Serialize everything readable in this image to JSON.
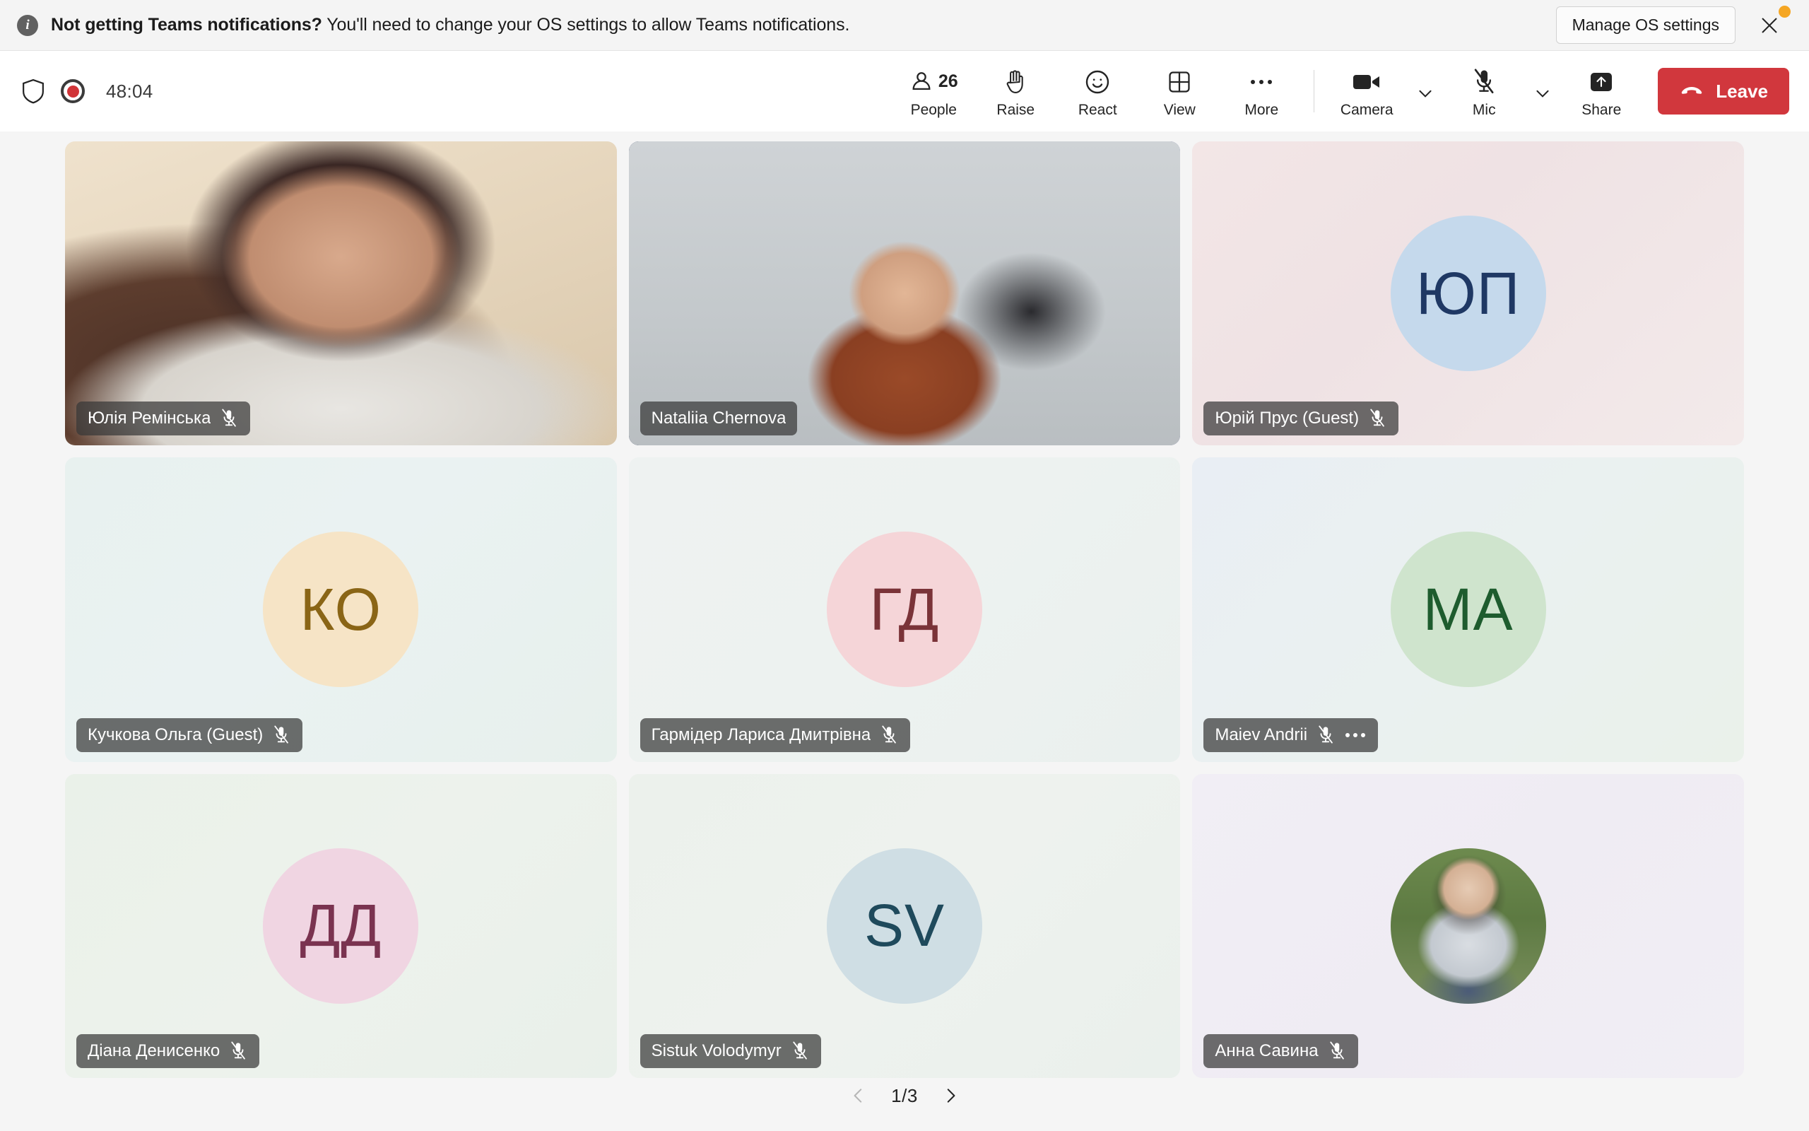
{
  "banner": {
    "icon": "info-icon",
    "title": "Not getting Teams notifications?",
    "message": " You'll need to change your OS settings to allow Teams notifications.",
    "action_label": "Manage OS settings",
    "close_icon": "close-icon",
    "badge_color": "#f5a623"
  },
  "toolbar": {
    "shield_icon": "shield-icon",
    "recording_icon": "record-icon",
    "recording_color": "#d13438",
    "timer": "48:04",
    "items": [
      {
        "label": "People",
        "icon": "people-icon",
        "count": "26"
      },
      {
        "label": "Raise",
        "icon": "raise-hand-icon"
      },
      {
        "label": "React",
        "icon": "react-smiley-icon"
      },
      {
        "label": "View",
        "icon": "view-grid-icon"
      },
      {
        "label": "More",
        "icon": "more-ellipsis-icon"
      }
    ],
    "camera": {
      "label": "Camera",
      "icon": "camera-icon",
      "chevron": "chevron-down-icon"
    },
    "mic": {
      "label": "Mic",
      "icon": "mic-muted-icon",
      "chevron": "chevron-down-icon"
    },
    "share": {
      "label": "Share",
      "icon": "share-screen-icon"
    },
    "leave": {
      "label": "Leave",
      "icon": "call-end-icon",
      "color": "#d1373d"
    }
  },
  "grid": {
    "tiles": [
      {
        "name": "Юлія Ремінська",
        "kind": "video",
        "photo_class": "ph-yuliia",
        "muted": true,
        "active_speaker": false,
        "has_overflow": false
      },
      {
        "name": "Nataliia Chernova",
        "kind": "video",
        "photo_class": "ph-nataliia",
        "muted": false,
        "active_speaker": true,
        "has_overflow": false
      },
      {
        "name": "Юрій Прус (Guest)",
        "kind": "initials",
        "initials": "ЮП",
        "avatar_bg": "#c5d9ec",
        "avatar_fg": "#1f3864",
        "tile_bg": "linear-gradient(135deg, #f3e6e6 0%, #efe2e4 40%, #f3eaea 100%)",
        "muted": true,
        "active_speaker": false,
        "has_overflow": false
      },
      {
        "name": "Кучкова Ольга (Guest)",
        "kind": "initials",
        "initials": "КО",
        "avatar_bg": "#f6e4c6",
        "avatar_fg": "#8a6516",
        "tile_bg": "linear-gradient(135deg, #e8f1ef 0%, #eaf2f2 45%, #e7f0ec 100%)",
        "muted": true,
        "active_speaker": false,
        "has_overflow": false
      },
      {
        "name": "Гармідер Лариса Дмитрівна",
        "kind": "initials",
        "initials": "ГД",
        "avatar_bg": "#f5d5d8",
        "avatar_fg": "#7a3338",
        "tile_bg": "linear-gradient(135deg, #eef2f1 0%, #edf2f0 50%, #eaf0ee 100%)",
        "muted": true,
        "active_speaker": false,
        "has_overflow": false
      },
      {
        "name": "Maiev Andrii",
        "kind": "initials",
        "initials": "МА",
        "avatar_bg": "#cfe4cd",
        "avatar_fg": "#1e5c2e",
        "tile_bg": "linear-gradient(135deg, #e9eef4 0%, #eaf1f0 50%, #eaf1ea 100%)",
        "muted": true,
        "active_speaker": false,
        "has_overflow": true,
        "overflow_icon": "more-ellipsis-icon"
      },
      {
        "name": "Діана Денисенко",
        "kind": "initials",
        "initials": "ДД",
        "avatar_bg": "#f0d5e2",
        "avatar_fg": "#7a3350",
        "tile_bg": "linear-gradient(135deg, #eaf1e9 0%, #edf2ec 50%, #e9f0ea 100%)",
        "muted": true,
        "active_speaker": false,
        "has_overflow": false
      },
      {
        "name": "Sistuk Volodymyr",
        "kind": "initials",
        "initials": "SV",
        "avatar_bg": "#cfdee4",
        "avatar_fg": "#1f4a5c",
        "tile_bg": "linear-gradient(135deg, #ecf1ec 0%, #eef2ee 50%, #eaf0ec 100%)",
        "muted": true,
        "active_speaker": false,
        "has_overflow": false
      },
      {
        "name": "Анна Савина",
        "kind": "photo",
        "photo_class": "ph-anna",
        "tile_bg": "linear-gradient(135deg, #f1eef5 0%, #efecf3 50%, #f1eef4 100%)",
        "muted": true,
        "active_speaker": false,
        "has_overflow": false
      }
    ]
  },
  "pagination": {
    "prev_icon": "chevron-left-icon",
    "next_icon": "chevron-right-icon",
    "label": "1/3"
  }
}
